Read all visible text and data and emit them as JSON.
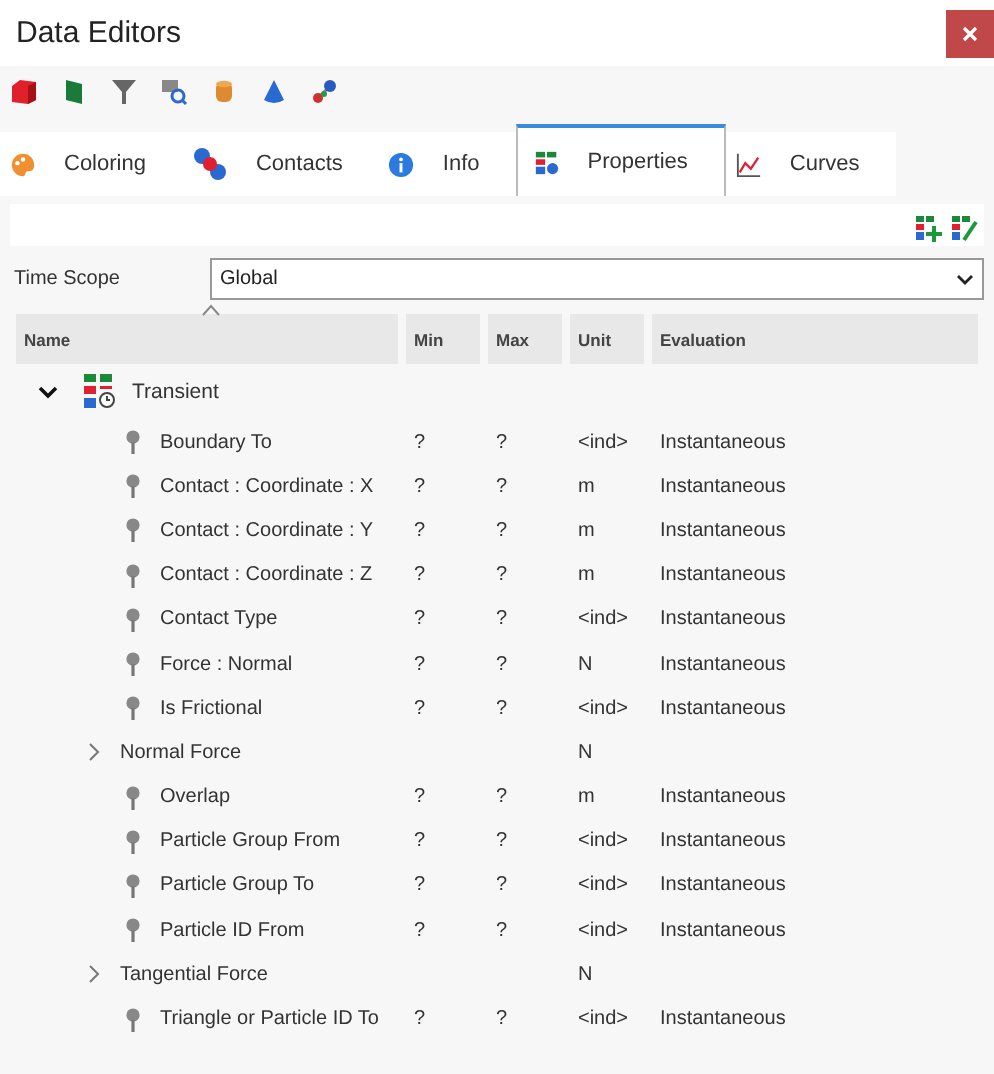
{
  "window": {
    "title": "Data Editors"
  },
  "toolbar": [
    {
      "kind": "cube"
    },
    {
      "kind": "flag"
    },
    {
      "kind": "filter"
    },
    {
      "kind": "search"
    },
    {
      "kind": "cylinder"
    },
    {
      "kind": "cone"
    },
    {
      "kind": "spheres"
    }
  ],
  "tabs": [
    {
      "label": "Coloring",
      "kind": "palette",
      "selected": false
    },
    {
      "label": "Contacts",
      "kind": "contacts",
      "selected": false
    },
    {
      "label": "Info",
      "kind": "info",
      "selected": false
    },
    {
      "label": "Properties",
      "kind": "properties",
      "selected": true
    },
    {
      "label": "Curves",
      "kind": "curves",
      "selected": false
    }
  ],
  "time_scope": {
    "label": "Time Scope",
    "value": "Global"
  },
  "table": {
    "columns": [
      "Name",
      "Min",
      "Max",
      "Unit",
      "Evaluation"
    ],
    "rows": [
      {
        "kind": "group",
        "name": "Transient",
        "expanded": true,
        "children": [
          {
            "kind": "property",
            "name": "Boundary To",
            "min": "?",
            "max": "?",
            "unit": "<ind>",
            "evaluation": "Instantaneous"
          },
          {
            "kind": "property",
            "name": "Contact : Coordinate : X",
            "min": "?",
            "max": "?",
            "unit": "m",
            "evaluation": "Instantaneous"
          },
          {
            "kind": "property",
            "name": "Contact : Coordinate : Y",
            "min": "?",
            "max": "?",
            "unit": "m",
            "evaluation": "Instantaneous"
          },
          {
            "kind": "property",
            "name": "Contact : Coordinate : Z",
            "min": "?",
            "max": "?",
            "unit": "m",
            "evaluation": "Instantaneous"
          },
          {
            "kind": "property",
            "name": "Contact Type",
            "min": "?",
            "max": "?",
            "unit": "<ind>",
            "evaluation": "Instantaneous"
          },
          {
            "kind": "property",
            "name": "Force : Normal",
            "min": "?",
            "max": "?",
            "unit": "N",
            "evaluation": "Instantaneous"
          },
          {
            "kind": "property",
            "name": "Is Frictional",
            "min": "?",
            "max": "?",
            "unit": "<ind>",
            "evaluation": "Instantaneous"
          },
          {
            "kind": "group",
            "name": "Normal Force",
            "expanded": false,
            "unit": "N"
          },
          {
            "kind": "property",
            "name": "Overlap",
            "min": "?",
            "max": "?",
            "unit": "m",
            "evaluation": "Instantaneous"
          },
          {
            "kind": "property",
            "name": "Particle Group From",
            "min": "?",
            "max": "?",
            "unit": "<ind>",
            "evaluation": "Instantaneous"
          },
          {
            "kind": "property",
            "name": "Particle Group To",
            "min": "?",
            "max": "?",
            "unit": "<ind>",
            "evaluation": "Instantaneous"
          },
          {
            "kind": "property",
            "name": "Particle ID From",
            "min": "?",
            "max": "?",
            "unit": "<ind>",
            "evaluation": "Instantaneous"
          },
          {
            "kind": "group",
            "name": "Tangential Force",
            "expanded": false,
            "unit": "N"
          },
          {
            "kind": "property",
            "name": "Triangle or Particle ID To",
            "min": "?",
            "max": "?",
            "unit": "<ind>",
            "evaluation": "Instantaneous"
          }
        ]
      }
    ]
  }
}
